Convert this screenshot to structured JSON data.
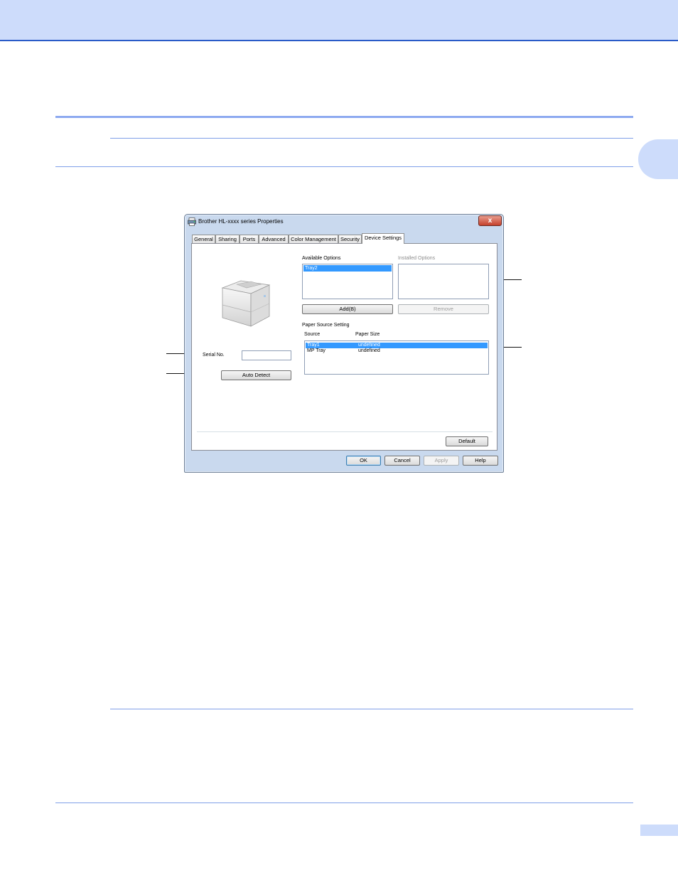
{
  "dialog": {
    "title": "Brother HL-xxxx series Properties",
    "close_glyph": "x",
    "tabs": [
      {
        "label": "General"
      },
      {
        "label": "Sharing"
      },
      {
        "label": "Ports"
      },
      {
        "label": "Advanced"
      },
      {
        "label": "Color Management"
      },
      {
        "label": "Security"
      },
      {
        "label": "Device Settings"
      }
    ],
    "active_tab": "Device Settings",
    "available_options": {
      "label": "Available Options",
      "items": [
        "Tray2"
      ],
      "selected": "Tray2",
      "add_button": "Add(B)"
    },
    "installed_options": {
      "label": "Installed Options",
      "items": [],
      "remove_button": "Remove"
    },
    "paper_source": {
      "label": "Paper Source Setting",
      "columns": [
        "Source",
        "Paper Size"
      ],
      "rows": [
        {
          "source": "Tray1",
          "size": "undefined",
          "selected": true
        },
        {
          "source": "MP Tray",
          "size": "undefined",
          "selected": false
        }
      ]
    },
    "serial": {
      "label": "Serial No.",
      "value": ""
    },
    "auto_detect_button": "Auto Detect",
    "default_button": "Default",
    "footer_buttons": {
      "ok": "OK",
      "cancel": "Cancel",
      "apply": "Apply",
      "help": "Help"
    }
  },
  "colors": {
    "banner": "#cddcfb",
    "accent_line": "#2a5bc8",
    "rule": "#7f9fe8",
    "selection": "#3399ff",
    "window_frame": "#c9d9ee"
  }
}
